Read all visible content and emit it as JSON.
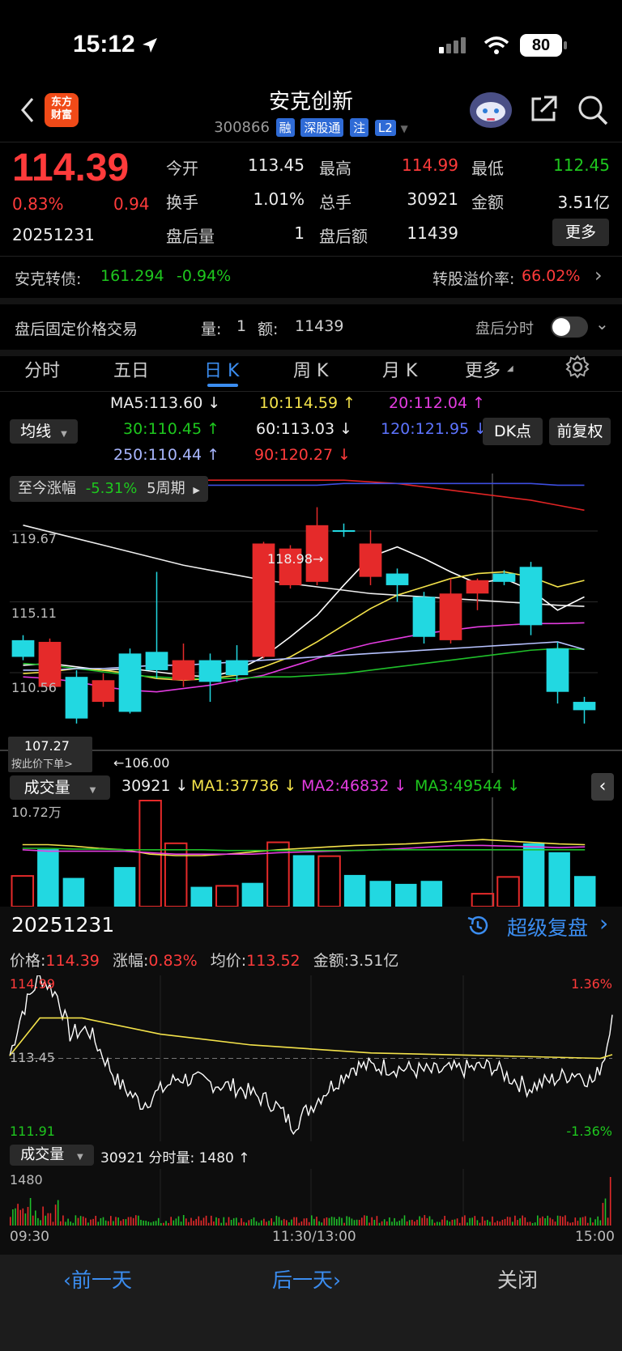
{
  "status": {
    "time": "15:12",
    "battery": "80"
  },
  "header": {
    "logo_text": "东方\n财富",
    "stock_name": "安克创新",
    "stock_code": "300866",
    "tags": [
      "融",
      "深股通",
      "注",
      "L2"
    ]
  },
  "quote": {
    "price": "114.39",
    "change_pct": "0.83%",
    "change_amt": "0.94",
    "date": "20251231",
    "fields": [
      {
        "label": "今开",
        "value": "113.45",
        "color": "#ececec"
      },
      {
        "label": "最高",
        "value": "114.99",
        "color": "#ff3b3b"
      },
      {
        "label": "最低",
        "value": "112.45",
        "color": "#1ec71e"
      },
      {
        "label": "换手",
        "value": "1.01%",
        "color": "#ececec"
      },
      {
        "label": "总手",
        "value": "30921",
        "color": "#ececec"
      },
      {
        "label": "金额",
        "value": "3.51亿",
        "color": "#ececec"
      },
      {
        "label": "盘后量",
        "value": "1",
        "color": "#ececec"
      },
      {
        "label": "盘后额",
        "value": "11439",
        "color": "#ececec"
      }
    ],
    "more_button": "更多"
  },
  "bond": {
    "label": "安克转债:",
    "price": "161.294",
    "change": "-0.94%",
    "premium_label": "转股溢价率:",
    "premium_value": "66.02%"
  },
  "after_hours": {
    "label": "盘后固定价格交易",
    "volume_label": "量:",
    "volume": "1",
    "amount_label": "额:",
    "amount": "11439",
    "toggle_label": "盘后分时",
    "toggle_on": false
  },
  "tabs": [
    "分时",
    "五日",
    "日 K",
    "周 K",
    "月 K",
    "更多"
  ],
  "active_tab": "日 K",
  "ma": {
    "selector": "均线",
    "ma5": "MA5:113.60 ↓",
    "ma10": "10:114.59 ↑",
    "ma20": "20:112.04 ↑",
    "ma30": "30:110.45 ↑",
    "ma60": "60:113.03 ↓",
    "ma120": "120:121.95 ↓",
    "ma250": "250:110.44 ↑",
    "ma90": "90:120.27 ↓",
    "dk_button": "DK点",
    "fq_button": "前复权"
  },
  "kline": {
    "range_chip_label": "至今涨幅",
    "range_chip_value": "-5.31%",
    "range_chip_period": "5周期",
    "axis_top": "119.67",
    "axis_mid": "115.11",
    "axis_low": "110.56",
    "high_marker": "118.98→",
    "low_marker": "←106.00",
    "cursor_price": "107.27",
    "cursor_hint": "按此价下单>"
  },
  "volume_panel": {
    "selector": "成交量",
    "vol": "30921 ↓",
    "ma1": "MA1:37736 ↓",
    "ma2": "MA2:46832 ↓",
    "ma3": "MA3:49544 ↓",
    "axis_max": "10.72万"
  },
  "detail": {
    "date": "20251231",
    "replay_label": "超级复盘",
    "price_label": "价格:",
    "price": "114.39",
    "pct_label": "涨幅:",
    "pct": "0.83%",
    "avg_label": "均价:",
    "avg": "113.52",
    "amt_label": "金额:",
    "amt": "3.51亿",
    "axis_high": "114.99",
    "axis_base": "113.45",
    "axis_low": "111.91",
    "pct_high": "1.36%",
    "pct_low": "-1.36%",
    "vol_selector": "成交量",
    "vol_text": "30921 分时量: 1480 ↑",
    "vol_axis": "1480",
    "time_start": "09:30",
    "time_mid": "11:30/13:00",
    "time_end": "15:00"
  },
  "footer": {
    "prev": "前一天",
    "next": "后一天",
    "close": "关闭"
  },
  "chart_data": [
    {
      "type": "candlestick",
      "title": "",
      "ylim": [
        104.0,
        121.0
      ],
      "candles": [
        {
          "o": 111.0,
          "c": 110.0,
          "h": 111.3,
          "l": 109.8
        },
        {
          "o": 108.2,
          "c": 110.9,
          "h": 111.1,
          "l": 108.0
        },
        {
          "o": 108.8,
          "c": 106.3,
          "h": 109.2,
          "l": 106.0
        },
        {
          "o": 107.3,
          "c": 108.6,
          "h": 109.0,
          "l": 107.0
        },
        {
          "o": 110.2,
          "c": 106.7,
          "h": 110.5,
          "l": 106.6
        },
        {
          "o": 110.3,
          "c": 109.2,
          "h": 115.1,
          "l": 108.7
        },
        {
          "o": 108.6,
          "c": 109.8,
          "h": 110.8,
          "l": 108.2
        },
        {
          "o": 109.8,
          "c": 108.5,
          "h": 110.2,
          "l": 107.3
        },
        {
          "o": 109.8,
          "c": 108.9,
          "h": 110.7,
          "l": 108.5
        },
        {
          "o": 110.0,
          "c": 116.8,
          "h": 116.9,
          "l": 109.9
        },
        {
          "o": 114.3,
          "c": 116.5,
          "h": 116.7,
          "l": 114.1
        },
        {
          "o": 114.5,
          "c": 117.9,
          "h": 118.98,
          "l": 114.3
        },
        {
          "o": 117.6,
          "c": 117.5,
          "h": 118.0,
          "l": 117.2
        },
        {
          "o": 114.8,
          "c": 116.8,
          "h": 117.6,
          "l": 114.3
        },
        {
          "o": 115.0,
          "c": 114.3,
          "h": 115.3,
          "l": 113.3
        },
        {
          "o": 113.6,
          "c": 111.2,
          "h": 113.9,
          "l": 110.8
        },
        {
          "o": 111.0,
          "c": 113.8,
          "h": 114.7,
          "l": 110.8
        },
        {
          "o": 113.8,
          "c": 114.6,
          "h": 114.7,
          "l": 112.8
        },
        {
          "o": 115.0,
          "c": 114.5,
          "h": 115.2,
          "l": 114.3
        },
        {
          "o": 115.4,
          "c": 111.9,
          "h": 115.7,
          "l": 111.3
        },
        {
          "o": 110.5,
          "c": 107.9,
          "h": 110.9,
          "l": 107.2
        },
        {
          "o": 107.3,
          "c": 106.8,
          "h": 107.6,
          "l": 106.0
        }
      ],
      "ma5": [
        109.5,
        109.6,
        109.4,
        109.2,
        109.3,
        109.1,
        108.9,
        108.8,
        109.2,
        110.0,
        111.2,
        112.5,
        114.3,
        116.0,
        116.6,
        115.9,
        115.1,
        114.4,
        114.7,
        114.0,
        112.8,
        113.6
      ],
      "ma10": [
        109.0,
        109.1,
        109.3,
        109.2,
        109.0,
        108.7,
        108.6,
        108.7,
        108.9,
        109.4,
        110.0,
        110.9,
        111.9,
        112.9,
        113.7,
        114.2,
        114.7,
        115.0,
        115.1,
        114.8,
        114.2,
        114.59
      ],
      "ma20": [
        108.8,
        108.7,
        108.5,
        108.2,
        108.0,
        107.9,
        108.1,
        108.3,
        108.6,
        108.9,
        109.4,
        109.9,
        110.4,
        110.8,
        111.1,
        111.4,
        111.6,
        111.8,
        111.9,
        112.0,
        112.0,
        112.04
      ],
      "ma30": [
        109.6,
        109.5,
        109.3,
        109.1,
        108.9,
        108.8,
        108.7,
        108.7,
        108.7,
        108.8,
        108.8,
        108.9,
        109.0,
        109.2,
        109.4,
        109.6,
        109.8,
        110.0,
        110.2,
        110.4,
        110.5,
        110.45
      ],
      "ma60": [
        117.9,
        117.5,
        117.1,
        116.7,
        116.3,
        115.9,
        115.5,
        115.2,
        114.9,
        114.6,
        114.4,
        114.2,
        114.0,
        113.8,
        113.7,
        113.6,
        113.5,
        113.4,
        113.3,
        113.2,
        113.1,
        113.03
      ],
      "ma90": [
        120.6,
        120.6,
        120.6,
        120.6,
        120.6,
        120.6,
        120.6,
        120.6,
        120.6,
        120.6,
        120.6,
        120.6,
        120.6,
        120.5,
        120.4,
        120.2,
        120.0,
        119.8,
        119.6,
        119.4,
        119.1,
        118.8
      ],
      "ma120": [
        120.2,
        120.2,
        120.2,
        120.2,
        120.3,
        120.3,
        120.3,
        120.3,
        120.3,
        120.3,
        120.3,
        120.3,
        120.4,
        120.4,
        120.4,
        120.4,
        120.4,
        120.4,
        120.4,
        120.4,
        120.3,
        120.3
      ],
      "ma250": [
        109.2,
        109.2,
        109.3,
        109.3,
        109.4,
        109.5,
        109.5,
        109.6,
        109.7,
        109.8,
        109.9,
        110.0,
        110.1,
        110.2,
        110.3,
        110.4,
        110.5,
        110.6,
        110.7,
        110.8,
        110.9,
        110.44
      ]
    },
    {
      "type": "bar",
      "title": "成交量",
      "ylim": [
        0,
        107200
      ],
      "values": [
        31000,
        58000,
        29000,
        0,
        40000,
        107200,
        64000,
        20000,
        21000,
        24000,
        65000,
        52000,
        51000,
        32000,
        26000,
        23000,
        26000,
        0,
        13000,
        30000,
        64000,
        55000,
        30921
      ],
      "up": [
        true,
        false,
        false,
        true,
        false,
        true,
        true,
        false,
        true,
        false,
        true,
        false,
        true,
        false,
        false,
        false,
        false,
        true,
        true,
        true,
        false,
        false,
        false
      ]
    },
    {
      "type": "line",
      "title": "分时",
      "ylim": [
        111.91,
        114.99
      ],
      "base": 113.45
    }
  ]
}
